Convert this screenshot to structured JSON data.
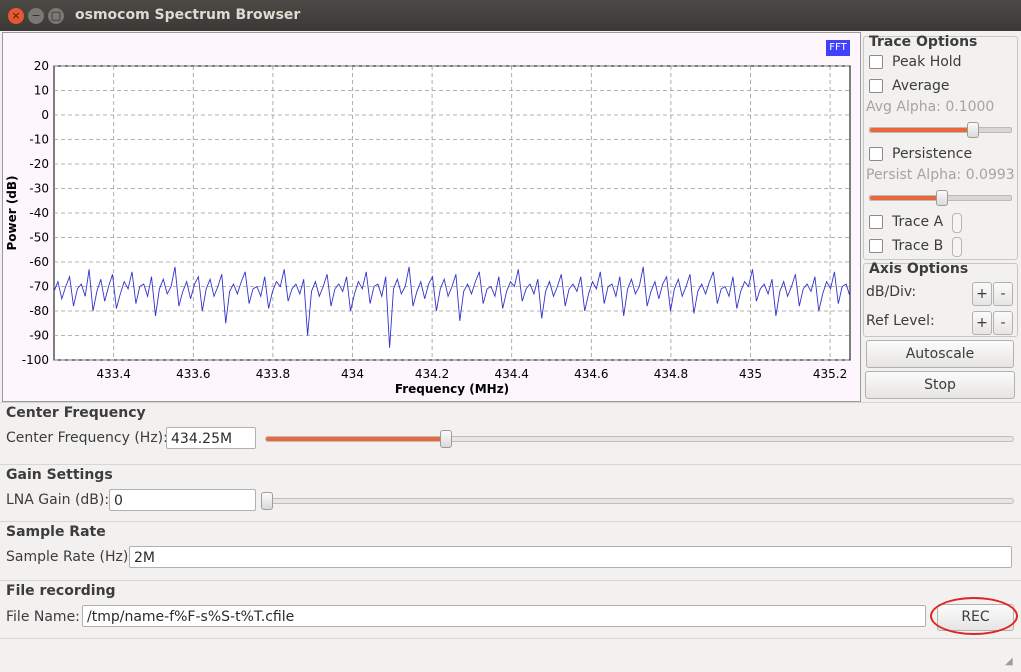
{
  "window": {
    "title": "osmocom Spectrum Browser",
    "close_glyph": "×",
    "min_glyph": "−",
    "max_glyph": "□"
  },
  "plot": {
    "tag": "FFT",
    "ylabel": "Power (dB)",
    "xlabel": "Frequency (MHz)",
    "yticks": [
      "20",
      "10",
      "0",
      "-10",
      "-20",
      "-30",
      "-40",
      "-50",
      "-60",
      "-70",
      "-80",
      "-90",
      "-100"
    ],
    "xticks": [
      "433.4",
      "433.6",
      "433.8",
      "434",
      "434.2",
      "434.4",
      "434.6",
      "434.8",
      "435",
      "435.2"
    ],
    "line_color": "#3333cc"
  },
  "chart_data": {
    "type": "line",
    "xlabel": "Frequency (MHz)",
    "ylabel": "Power (dB)",
    "xlim": [
      433.25,
      435.25
    ],
    "ylim": [
      -100,
      20
    ],
    "grid": true,
    "series": [
      {
        "values_note": "",
        "x_start": 433.25,
        "x_end": 435.25,
        "y": [
          -72,
          -68,
          -75,
          -70,
          -66,
          -78,
          -71,
          -69,
          -74,
          -63,
          -80,
          -72,
          -67,
          -76,
          -70,
          -65,
          -79,
          -73,
          -68,
          -71,
          -64,
          -77,
          -70,
          -69,
          -74,
          -66,
          -82,
          -71,
          -67,
          -73,
          -70,
          -62,
          -78,
          -72,
          -68,
          -75,
          -69,
          -66,
          -80,
          -71,
          -67,
          -74,
          -70,
          -65,
          -85,
          -72,
          -69,
          -73,
          -68,
          -64,
          -77,
          -71,
          -70,
          -74,
          -66,
          -79,
          -72,
          -68,
          -70,
          -63,
          -76,
          -71,
          -69,
          -73,
          -67,
          -90,
          -72,
          -68,
          -74,
          -70,
          -65,
          -78,
          -71,
          -69,
          -72,
          -66,
          -80,
          -73,
          -68,
          -71,
          -64,
          -77,
          -70,
          -69,
          -74,
          -66,
          -95,
          -71,
          -67,
          -73,
          -70,
          -62,
          -78,
          -72,
          -68,
          -75,
          -69,
          -66,
          -80,
          -71,
          -67,
          -74,
          -70,
          -65,
          -84,
          -72,
          -69,
          -73,
          -68,
          -64,
          -77,
          -71,
          -70,
          -74,
          -66,
          -79,
          -72,
          -68,
          -70,
          -63,
          -76,
          -71,
          -69,
          -73,
          -67,
          -83,
          -72,
          -68,
          -74,
          -70,
          -65,
          -78,
          -71,
          -69,
          -72,
          -66,
          -80,
          -73,
          -68,
          -71,
          -64,
          -77,
          -70,
          -69,
          -74,
          -66,
          -82,
          -71,
          -67,
          -73,
          -70,
          -62,
          -78,
          -72,
          -68,
          -75,
          -69,
          -66,
          -80,
          -71,
          -67,
          -74,
          -70,
          -65,
          -81,
          -72,
          -69,
          -73,
          -68,
          -64,
          -77,
          -71,
          -70,
          -74,
          -66,
          -79,
          -72,
          -68,
          -70,
          -63,
          -76,
          -71,
          -69,
          -73,
          -67,
          -82,
          -72,
          -68,
          -74,
          -70,
          -65,
          -78,
          -71,
          -69,
          -72,
          -66,
          -80,
          -73,
          -68,
          -71,
          -64,
          -77,
          -70,
          -69,
          -74
        ]
      }
    ]
  },
  "trace_options": {
    "title": "Trace Options",
    "peak_hold": "Peak Hold",
    "average": "Average",
    "avg_alpha": "Avg Alpha: 0.1000",
    "avg_alpha_value": 0.72,
    "persistence": "Persistence",
    "persist_alpha": "Persist Alpha: 0.0993",
    "persist_alpha_value": 0.5,
    "trace_a": "Trace A",
    "trace_b": "Trace B"
  },
  "axis_options": {
    "title": "Axis Options",
    "db_div": "dB/Div:",
    "ref_level": "Ref Level:",
    "plus": "+",
    "minus": "-",
    "autoscale": "Autoscale",
    "stop": "Stop"
  },
  "center_frequency": {
    "title": "Center Frequency",
    "label": "Center Frequency (Hz):",
    "value": "434.25M",
    "slider_value": 0.24
  },
  "gain": {
    "title": "Gain Settings",
    "label": "LNA Gain (dB):",
    "value": "0",
    "slider_value": 0.0
  },
  "sample_rate": {
    "title": "Sample Rate",
    "label": "Sample Rate (Hz):",
    "value": "2M"
  },
  "file_recording": {
    "title": "File recording",
    "label": "File Name:",
    "value": "/tmp/name-f%F-s%S-t%T.cfile",
    "rec": "REC"
  },
  "colors": {
    "accent": "#e9673a",
    "annotation": "#e02424",
    "fft_tag": "#4040ff"
  }
}
